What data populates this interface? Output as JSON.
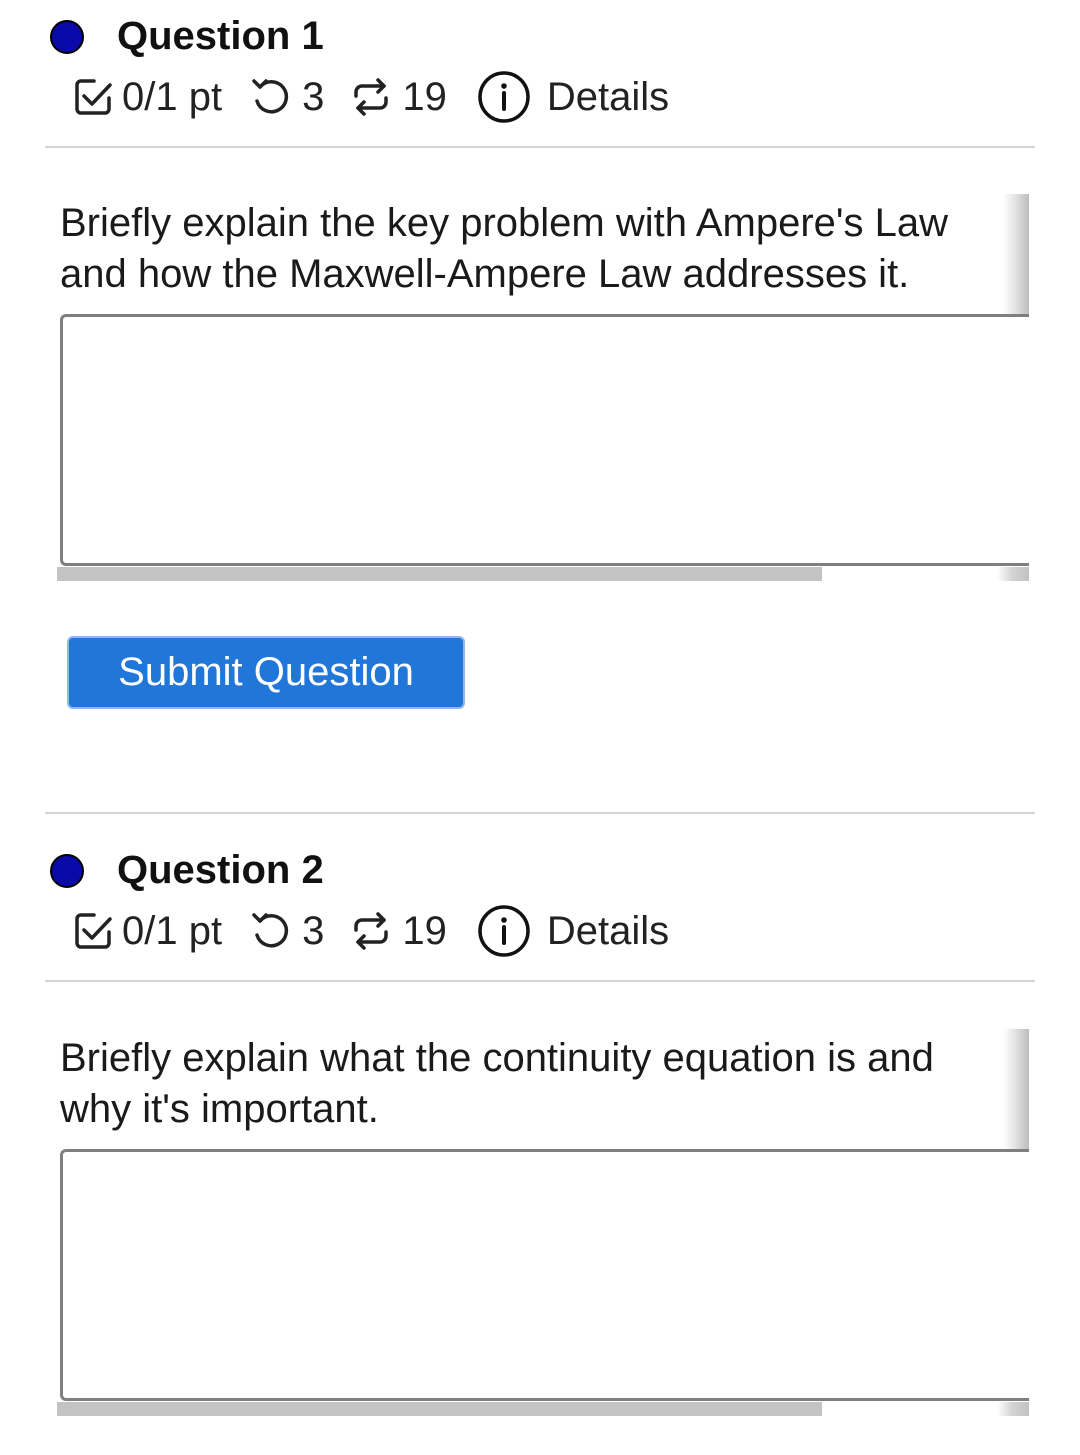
{
  "questions": [
    {
      "title": "Question 1",
      "score": "0/1 pt",
      "retries": "3",
      "submissions": "19",
      "details_label": "Details",
      "prompt_line1": "Briefly explain the key problem with Ampere's Law",
      "prompt_line2": "and how the Maxwell-Ampere Law addresses it.",
      "answer_value": ""
    },
    {
      "title": "Question 2",
      "score": "0/1 pt",
      "retries": "3",
      "submissions": "19",
      "details_label": "Details",
      "prompt_line1": "Briefly explain what the continuity equation is and",
      "prompt_line2": "why it's important.",
      "answer_value": ""
    }
  ],
  "submit_label": "Submit Question",
  "icons": {
    "status": "dot-icon",
    "score": "checkbox-icon",
    "retries": "retry-icon",
    "submissions": "repeat-icon",
    "details": "info-icon"
  },
  "colors": {
    "status_dot": "#0a0aa8",
    "button": "#2176d9",
    "button_text": "#ffffff",
    "divider": "#d4d4d4"
  }
}
